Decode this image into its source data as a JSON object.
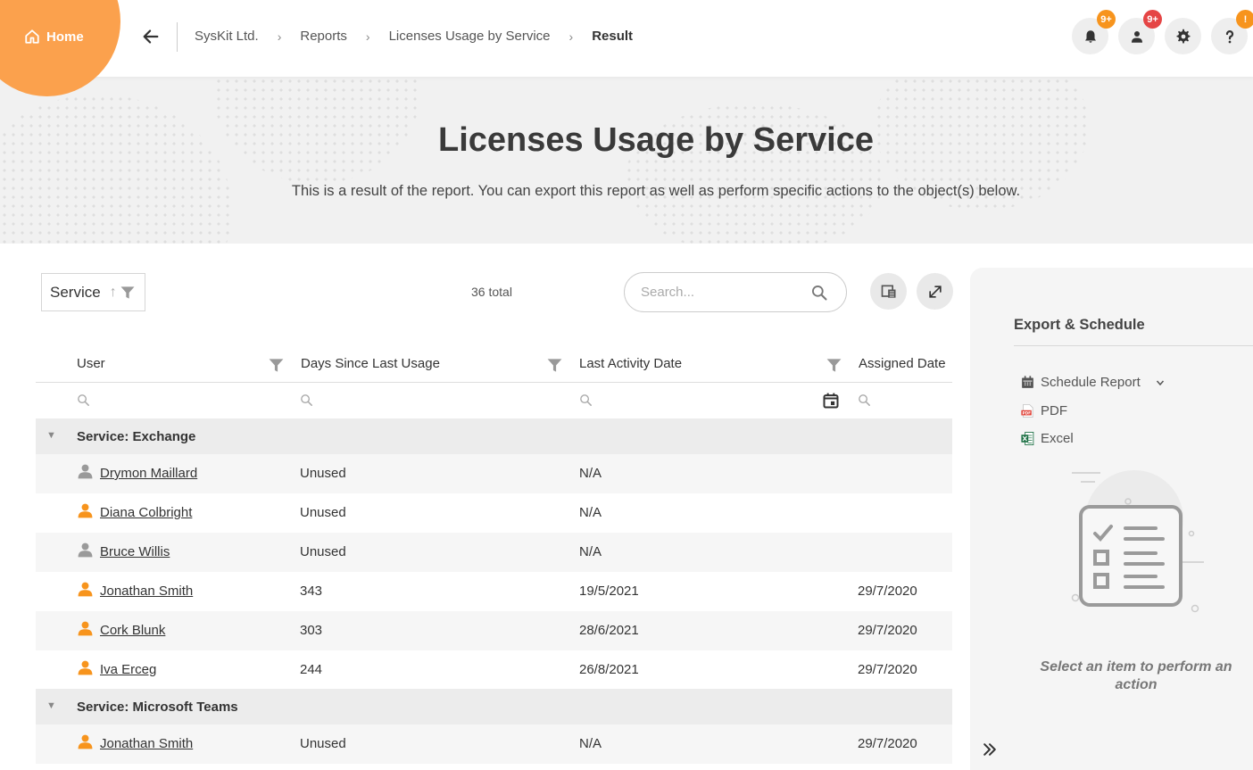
{
  "topbar": {
    "home_label": "Home",
    "breadcrumbs": [
      "SysKit Ltd.",
      "Reports",
      "Licenses Usage by Service"
    ],
    "current": "Result",
    "notifications_badge": "9+",
    "users_badge": "9+",
    "help_badge": "!",
    "colors": {
      "accent": "#fba14d",
      "badge_orange": "#f7941d",
      "badge_red": "#e54545"
    }
  },
  "hero": {
    "title": "Licenses Usage by Service",
    "subtitle": "This is a result of the report. You can export this report as well as perform specific actions to the object(s) below."
  },
  "toolbar": {
    "group_by": "Service",
    "total": "36 total",
    "search_placeholder": "Search..."
  },
  "grid": {
    "columns": [
      "User",
      "Days Since Last Usage",
      "Last Activity Date",
      "Assigned Date"
    ],
    "groups": [
      {
        "label": "Service: Exchange",
        "rows": [
          {
            "user": "Drymon Maillard",
            "days": "Unused",
            "last_activity": "N/A",
            "assigned": "",
            "icon": "user-gray-icon"
          },
          {
            "user": "Diana Colbright",
            "days": "Unused",
            "last_activity": "N/A",
            "assigned": "",
            "icon": "user-orange-icon"
          },
          {
            "user": "Bruce Willis",
            "days": "Unused",
            "last_activity": "N/A",
            "assigned": "",
            "icon": "user-gray-icon"
          },
          {
            "user": "Jonathan Smith",
            "days": "343",
            "last_activity": "19/5/2021",
            "assigned": "29/7/2020",
            "icon": "user-orange-icon"
          },
          {
            "user": "Cork Blunk",
            "days": "303",
            "last_activity": "28/6/2021",
            "assigned": "29/7/2020",
            "icon": "user-orange-icon"
          },
          {
            "user": "Iva Erceg",
            "days": "244",
            "last_activity": "26/8/2021",
            "assigned": "29/7/2020",
            "icon": "user-orange-icon"
          }
        ]
      },
      {
        "label": "Service: Microsoft Teams",
        "rows": [
          {
            "user": "Jonathan Smith",
            "days": "Unused",
            "last_activity": "N/A",
            "assigned": "29/7/2020",
            "icon": "user-orange-icon"
          }
        ]
      }
    ]
  },
  "panel": {
    "title": "Export & Schedule",
    "schedule_label": "Schedule Report",
    "pdf_label": "PDF",
    "excel_label": "Excel",
    "hint": "Select an item to perform an action"
  }
}
